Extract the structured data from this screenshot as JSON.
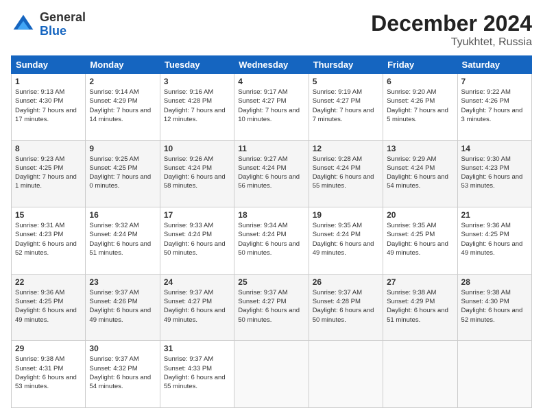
{
  "header": {
    "logo_general": "General",
    "logo_blue": "Blue",
    "month_title": "December 2024",
    "location": "Tyukhtet, Russia"
  },
  "days_of_week": [
    "Sunday",
    "Monday",
    "Tuesday",
    "Wednesday",
    "Thursday",
    "Friday",
    "Saturday"
  ],
  "weeks": [
    [
      {
        "day": "1",
        "sunrise": "9:13 AM",
        "sunset": "4:30 PM",
        "daylight": "7 hours and 17 minutes."
      },
      {
        "day": "2",
        "sunrise": "9:14 AM",
        "sunset": "4:29 PM",
        "daylight": "7 hours and 14 minutes."
      },
      {
        "day": "3",
        "sunrise": "9:16 AM",
        "sunset": "4:28 PM",
        "daylight": "7 hours and 12 minutes."
      },
      {
        "day": "4",
        "sunrise": "9:17 AM",
        "sunset": "4:27 PM",
        "daylight": "7 hours and 10 minutes."
      },
      {
        "day": "5",
        "sunrise": "9:19 AM",
        "sunset": "4:27 PM",
        "daylight": "7 hours and 7 minutes."
      },
      {
        "day": "6",
        "sunrise": "9:20 AM",
        "sunset": "4:26 PM",
        "daylight": "7 hours and 5 minutes."
      },
      {
        "day": "7",
        "sunrise": "9:22 AM",
        "sunset": "4:26 PM",
        "daylight": "7 hours and 3 minutes."
      }
    ],
    [
      {
        "day": "8",
        "sunrise": "9:23 AM",
        "sunset": "4:25 PM",
        "daylight": "7 hours and 1 minute."
      },
      {
        "day": "9",
        "sunrise": "9:25 AM",
        "sunset": "4:25 PM",
        "daylight": "7 hours and 0 minutes."
      },
      {
        "day": "10",
        "sunrise": "9:26 AM",
        "sunset": "4:24 PM",
        "daylight": "6 hours and 58 minutes."
      },
      {
        "day": "11",
        "sunrise": "9:27 AM",
        "sunset": "4:24 PM",
        "daylight": "6 hours and 56 minutes."
      },
      {
        "day": "12",
        "sunrise": "9:28 AM",
        "sunset": "4:24 PM",
        "daylight": "6 hours and 55 minutes."
      },
      {
        "day": "13",
        "sunrise": "9:29 AM",
        "sunset": "4:24 PM",
        "daylight": "6 hours and 54 minutes."
      },
      {
        "day": "14",
        "sunrise": "9:30 AM",
        "sunset": "4:23 PM",
        "daylight": "6 hours and 53 minutes."
      }
    ],
    [
      {
        "day": "15",
        "sunrise": "9:31 AM",
        "sunset": "4:23 PM",
        "daylight": "6 hours and 52 minutes."
      },
      {
        "day": "16",
        "sunrise": "9:32 AM",
        "sunset": "4:24 PM",
        "daylight": "6 hours and 51 minutes."
      },
      {
        "day": "17",
        "sunrise": "9:33 AM",
        "sunset": "4:24 PM",
        "daylight": "6 hours and 50 minutes."
      },
      {
        "day": "18",
        "sunrise": "9:34 AM",
        "sunset": "4:24 PM",
        "daylight": "6 hours and 50 minutes."
      },
      {
        "day": "19",
        "sunrise": "9:35 AM",
        "sunset": "4:24 PM",
        "daylight": "6 hours and 49 minutes."
      },
      {
        "day": "20",
        "sunrise": "9:35 AM",
        "sunset": "4:25 PM",
        "daylight": "6 hours and 49 minutes."
      },
      {
        "day": "21",
        "sunrise": "9:36 AM",
        "sunset": "4:25 PM",
        "daylight": "6 hours and 49 minutes."
      }
    ],
    [
      {
        "day": "22",
        "sunrise": "9:36 AM",
        "sunset": "4:25 PM",
        "daylight": "6 hours and 49 minutes."
      },
      {
        "day": "23",
        "sunrise": "9:37 AM",
        "sunset": "4:26 PM",
        "daylight": "6 hours and 49 minutes."
      },
      {
        "day": "24",
        "sunrise": "9:37 AM",
        "sunset": "4:27 PM",
        "daylight": "6 hours and 49 minutes."
      },
      {
        "day": "25",
        "sunrise": "9:37 AM",
        "sunset": "4:27 PM",
        "daylight": "6 hours and 50 minutes."
      },
      {
        "day": "26",
        "sunrise": "9:37 AM",
        "sunset": "4:28 PM",
        "daylight": "6 hours and 50 minutes."
      },
      {
        "day": "27",
        "sunrise": "9:38 AM",
        "sunset": "4:29 PM",
        "daylight": "6 hours and 51 minutes."
      },
      {
        "day": "28",
        "sunrise": "9:38 AM",
        "sunset": "4:30 PM",
        "daylight": "6 hours and 52 minutes."
      }
    ],
    [
      {
        "day": "29",
        "sunrise": "9:38 AM",
        "sunset": "4:31 PM",
        "daylight": "6 hours and 53 minutes."
      },
      {
        "day": "30",
        "sunrise": "9:37 AM",
        "sunset": "4:32 PM",
        "daylight": "6 hours and 54 minutes."
      },
      {
        "day": "31",
        "sunrise": "9:37 AM",
        "sunset": "4:33 PM",
        "daylight": "6 hours and 55 minutes."
      },
      null,
      null,
      null,
      null
    ]
  ]
}
